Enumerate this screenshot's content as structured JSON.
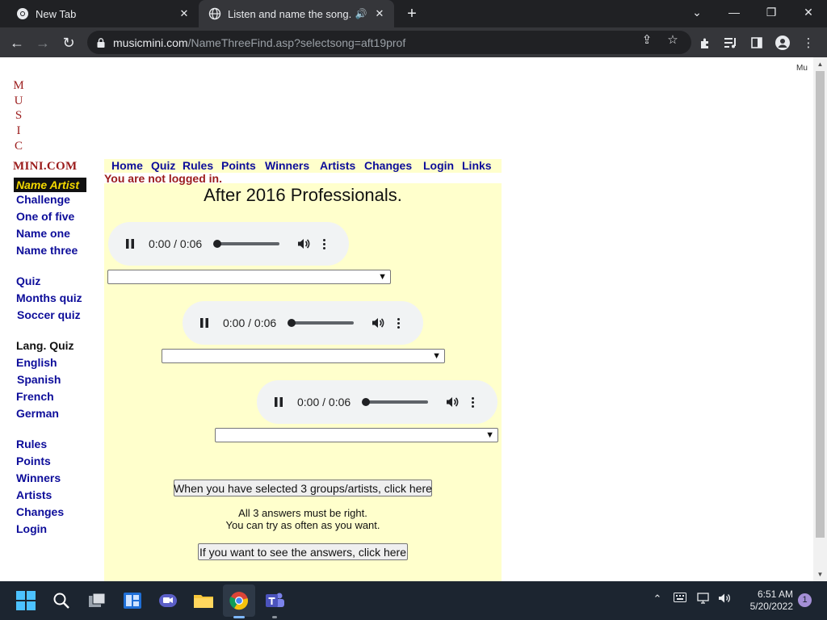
{
  "browser": {
    "tabs": [
      {
        "title": "New Tab"
      },
      {
        "title": "Listen and name the song. 8("
      }
    ],
    "url_host": "musicmini.com",
    "url_path": "/NameThreeFind.asp?selectsong=aft19prof"
  },
  "page": {
    "corner_text": "Mu",
    "logo_letters": [
      "M",
      "U",
      "S",
      "I",
      "C"
    ],
    "logo_mini": "MINI.COM",
    "sidebar": {
      "highlight": "Name Artist",
      "group1": [
        "Challenge",
        "One of five",
        "Name one",
        "Name three"
      ],
      "group2": [
        "Quiz",
        "Months quiz",
        "Soccer quiz"
      ],
      "lang_heading": "Lang. Quiz",
      "group3": [
        "English",
        "Spanish",
        "French",
        "German"
      ],
      "group4": [
        "Rules",
        "Points",
        "Winners",
        "Artists",
        "Changes",
        "Login"
      ]
    },
    "topnav": [
      "Home",
      "Quiz",
      "Rules",
      "Points",
      "Winners",
      "Artists",
      "Changes",
      "Login",
      "Links"
    ],
    "login_status": "You are not logged in.",
    "title": "After 2016 Professionals.",
    "players": [
      {
        "time": "0:00 / 0:06"
      },
      {
        "time": "0:00 / 0:06"
      },
      {
        "time": "0:00 / 0:06"
      }
    ],
    "submit_button": "When you have selected 3 groups/artists, click here",
    "note_line1": "All 3 answers must be right.",
    "note_line2": "You can try as often as you want.",
    "answers_button": "If you want to see the answers, click here"
  },
  "taskbar": {
    "time": "6:51 AM",
    "date": "5/20/2022",
    "notifications": "1"
  }
}
